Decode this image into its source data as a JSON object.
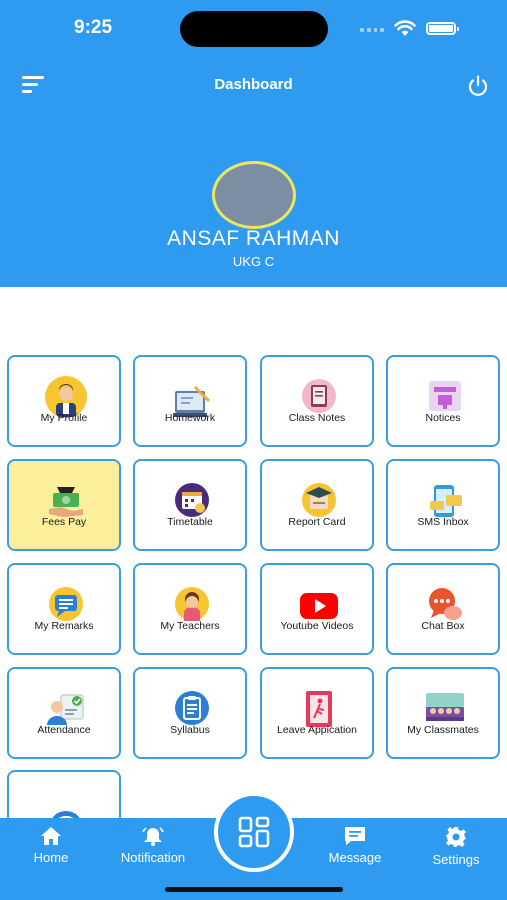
{
  "status_bar": {
    "time": "9:25"
  },
  "header": {
    "title": "Dashboard",
    "student_name": "ANSAF RAHMAN",
    "student_class": "UKG C"
  },
  "tiles": [
    {
      "label": "My Profile",
      "icon": "profile-icon"
    },
    {
      "label": "Homework",
      "icon": "homework-icon"
    },
    {
      "label": "Class Notes",
      "icon": "class-notes-icon"
    },
    {
      "label": "Notices",
      "icon": "notices-icon"
    },
    {
      "label": "Fees Pay",
      "icon": "fees-icon"
    },
    {
      "label": "Timetable",
      "icon": "timetable-icon"
    },
    {
      "label": "Report Card",
      "icon": "report-card-icon"
    },
    {
      "label": "SMS Inbox",
      "icon": "sms-inbox-icon"
    },
    {
      "label": "My Remarks",
      "icon": "remarks-icon"
    },
    {
      "label": "My Teachers",
      "icon": "teacher-icon"
    },
    {
      "label": "Youtube Videos",
      "icon": "youtube-icon"
    },
    {
      "label": "Chat Box",
      "icon": "chat-icon"
    },
    {
      "label": "Attendance",
      "icon": "attendance-icon"
    },
    {
      "label": "Syllabus",
      "icon": "syllabus-icon"
    },
    {
      "label": "Leave Appication",
      "icon": "leave-icon"
    },
    {
      "label": "My Classmates",
      "icon": "classmates-icon"
    },
    {
      "label": "",
      "icon": "clipboard-icon"
    }
  ],
  "bottom_nav": {
    "home": "Home",
    "notification": "Notification",
    "message": "Message",
    "settings": "Settings"
  },
  "colors": {
    "primary": "#2f9bf0",
    "tile_border": "#3a9ee0",
    "active_tile": "#fbef9c",
    "avatar_ring": "#e8e860"
  }
}
